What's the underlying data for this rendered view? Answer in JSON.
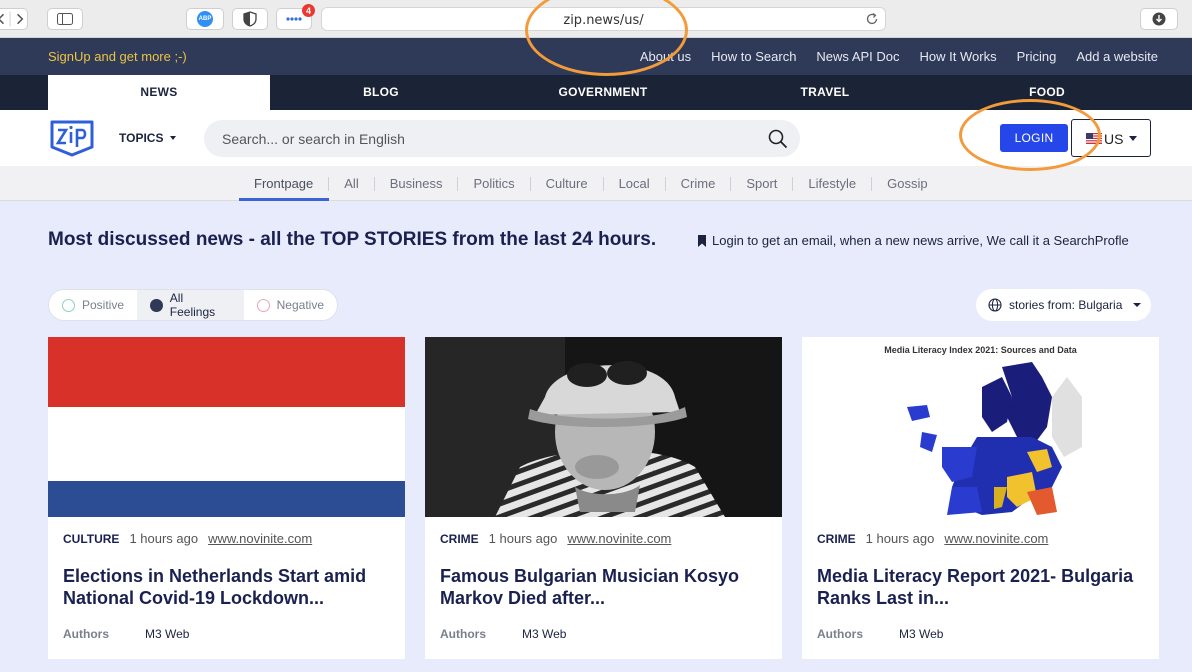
{
  "browser": {
    "url": "zip.news/us/",
    "notification_count": "4",
    "abp_label": "ABP"
  },
  "topbar": {
    "signup": "SignUp and get more ;-)",
    "links": [
      "About us",
      "How to Search",
      "News API Doc",
      "How It Works",
      "Pricing",
      "Add a website"
    ]
  },
  "category_tabs": [
    "NEWS",
    "BLOG",
    "GOVERNMENT",
    "TRAVEL",
    "FOOD"
  ],
  "active_tab": "NEWS",
  "header": {
    "topics": "TOPICS",
    "search_placeholder": "Search... or search in English",
    "login": "LOGIN",
    "language": "US"
  },
  "subnav": [
    "Frontpage",
    "All",
    "Business",
    "Politics",
    "Culture",
    "Local",
    "Crime",
    "Sport",
    "Lifestyle",
    "Gossip"
  ],
  "main": {
    "headline": "Most discussed news - all the TOP STORIES from the last 24 hours.",
    "promo": "Login to get an email, when a new news arrive, We call it a SearchProfle"
  },
  "feelings": [
    "Positive",
    "All Feelings",
    "Negative"
  ],
  "stories_from": "stories from: Bulgaria",
  "cards": [
    {
      "category": "CULTURE",
      "time": "1 hours ago",
      "source": "www.novinite.com",
      "title": "Elections in Netherlands Start amid National Covid-19 Lockdown...",
      "authors_label": "Authors",
      "author": "M3 Web"
    },
    {
      "category": "CRIME",
      "time": "1 hours ago",
      "source": "www.novinite.com",
      "title": "Famous Bulgarian Musician Kosyo Markov Died after...",
      "authors_label": "Authors",
      "author": "M3 Web"
    },
    {
      "category": "CRIME",
      "time": "1 hours ago",
      "source": "www.novinite.com",
      "title": "Media Literacy Report 2021- Bulgaria Ranks Last in...",
      "authors_label": "Authors",
      "author": "M3 Web",
      "image_caption": "Media Literacy Index 2021: Sources and Data"
    }
  ],
  "colors": {
    "accent": "#2547ea",
    "topbar": "#2e3a57",
    "tabs": "#1b2336",
    "signup": "#ecc345",
    "page_bg": "#e7ebfb",
    "highlight": "#f39a3b"
  }
}
